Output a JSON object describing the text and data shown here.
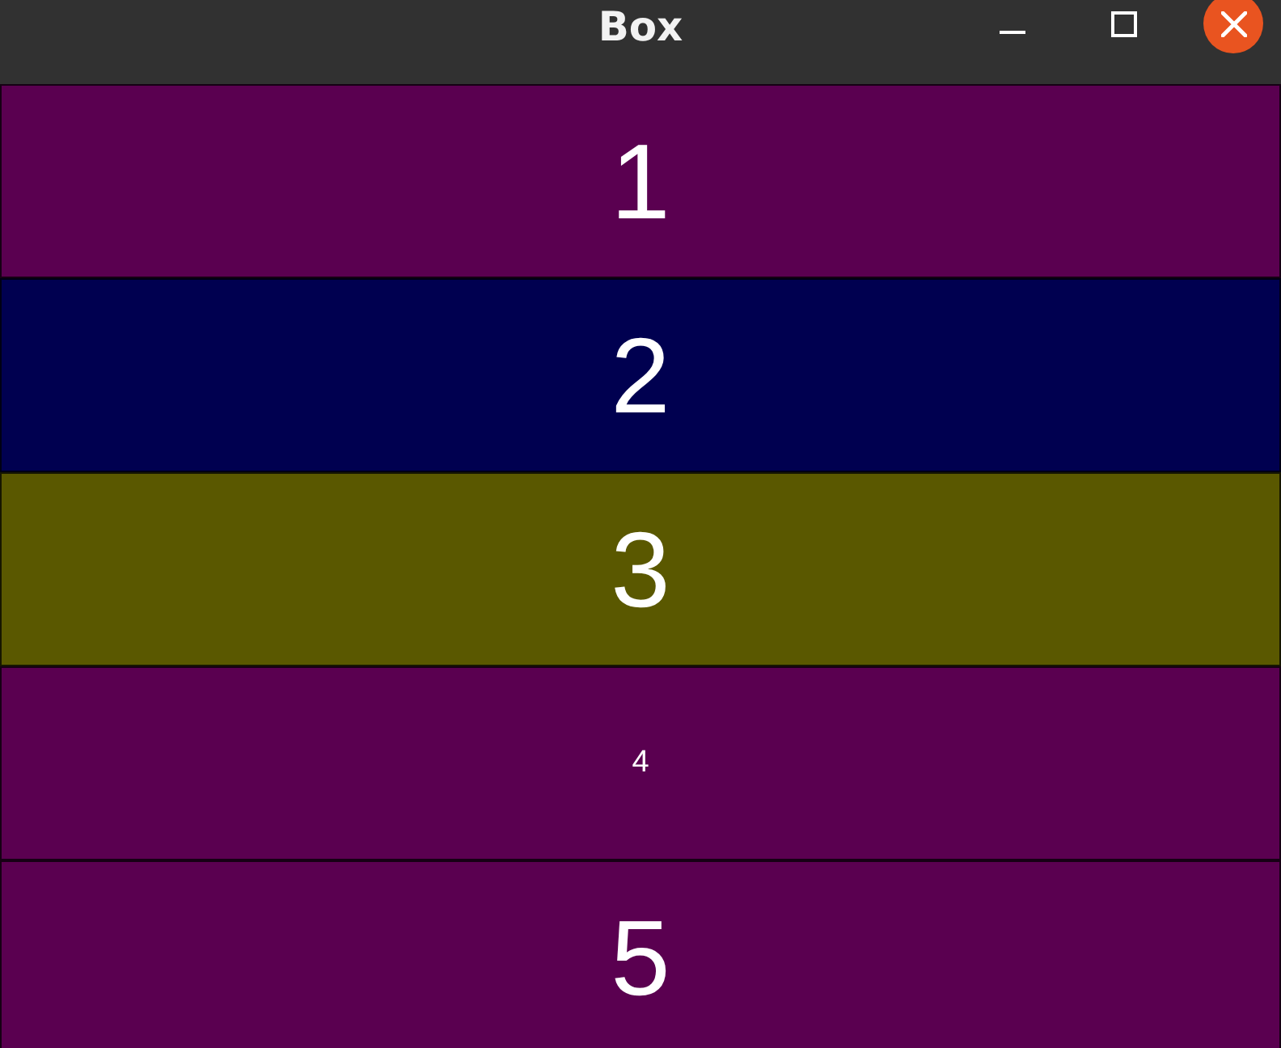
{
  "window": {
    "title": "Box"
  },
  "boxes": [
    {
      "label": "1",
      "kind": "large",
      "color": "#5a0050"
    },
    {
      "label": "2",
      "kind": "large",
      "color": "#000050"
    },
    {
      "label": "3",
      "kind": "large",
      "color": "#5a5800"
    },
    {
      "label": "4",
      "kind": "small",
      "color": "#5a0050"
    },
    {
      "label": "5",
      "kind": "large",
      "color": "#5a0050"
    }
  ]
}
